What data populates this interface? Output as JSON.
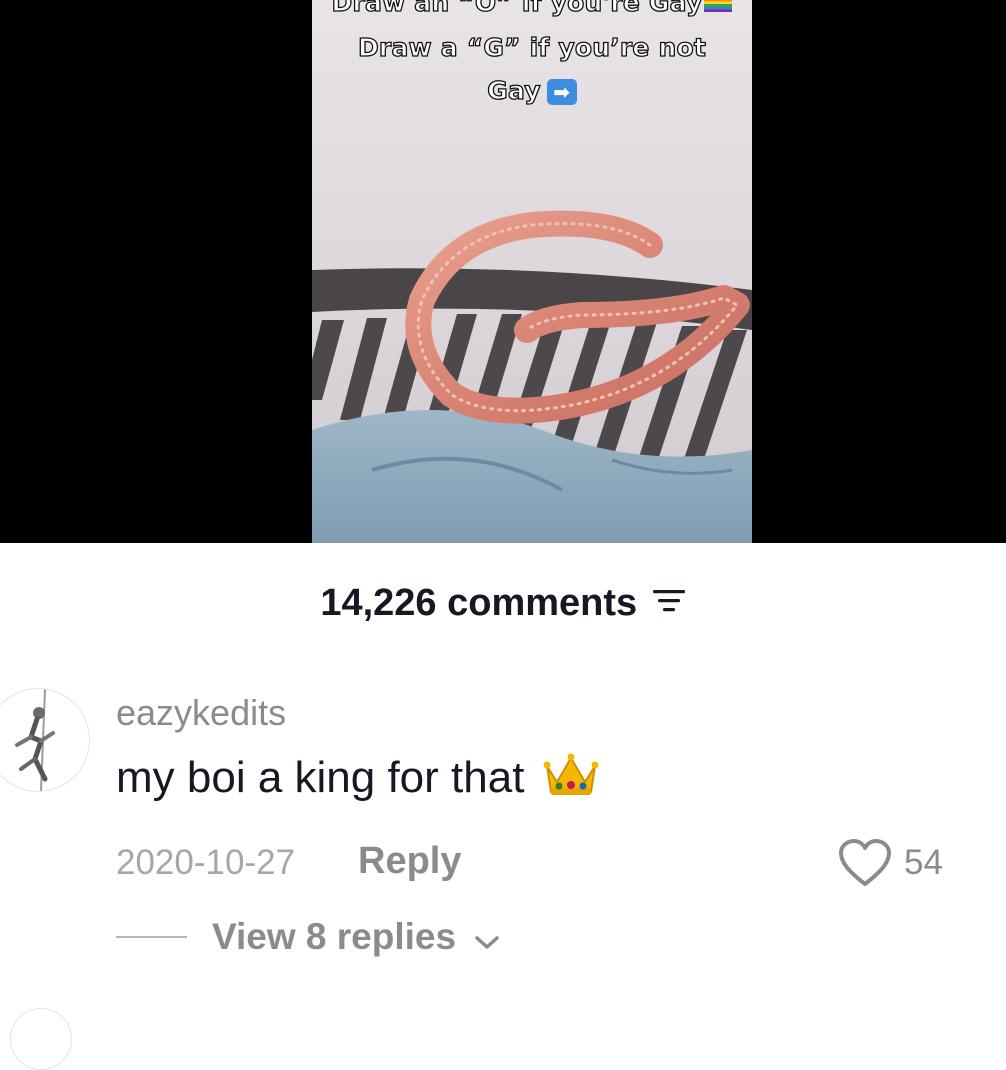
{
  "video": {
    "caption_line1": "Draw an “O” if you're Gay",
    "caption_line2": "Draw a “G” if you’re not",
    "caption_line3": "Gay",
    "arrow_glyph": "➡"
  },
  "comments": {
    "count_label": "14,226 comments"
  },
  "comment": {
    "username": "eazykedits",
    "text": "my boi a king for that",
    "date": "2020-10-27",
    "reply_label": "Reply",
    "like_count": "54",
    "view_replies_label": "View 8 replies"
  },
  "colors": {
    "primary_text": "#161823",
    "secondary_text": "#8a8b91",
    "video_bg": "#000000"
  },
  "icons": {
    "filter": "filter-icon",
    "like": "heart-icon",
    "expand": "chevron-down-icon",
    "emoji": "crown-emoji"
  }
}
